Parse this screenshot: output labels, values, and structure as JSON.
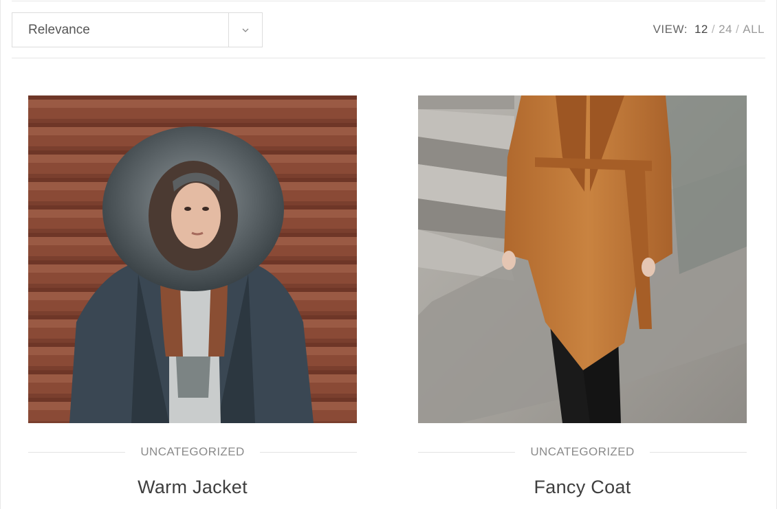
{
  "toolbar": {
    "sort_value": "Relevance",
    "view_label": "VIEW:",
    "view_options": [
      "12",
      "24",
      "ALL"
    ],
    "view_active": "12",
    "view_separator": "/"
  },
  "products": [
    {
      "category": "UNCATEGORIZED",
      "title": "Warm Jacket"
    },
    {
      "category": "UNCATEGORIZED",
      "title": "Fancy Coat"
    }
  ],
  "colors": {
    "text_dark": "#3e3e3e",
    "text_muted": "#8a8a8a",
    "border": "#dcdcdc",
    "rule": "#e6e6e6"
  }
}
